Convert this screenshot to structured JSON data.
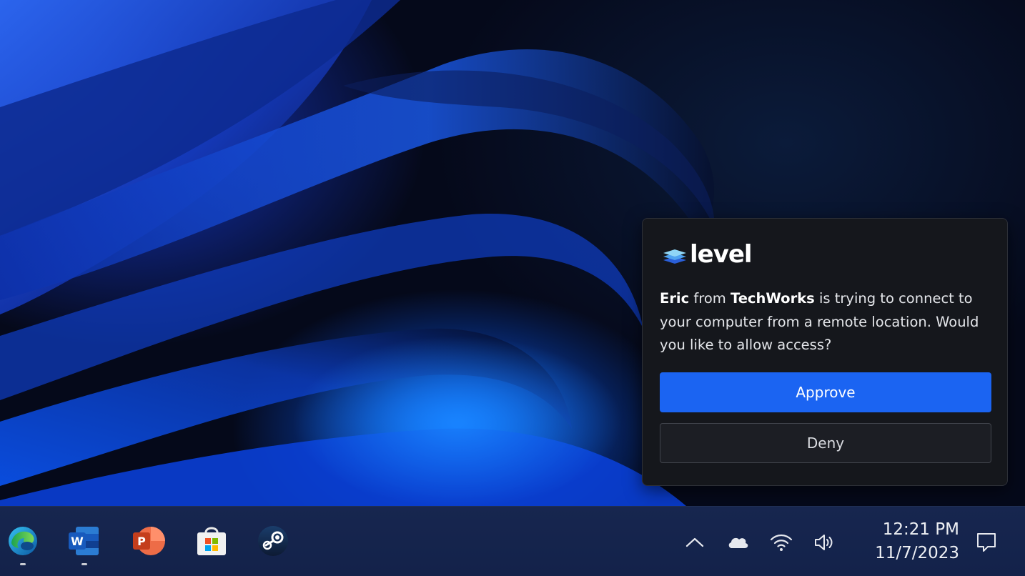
{
  "notification": {
    "brand_name": "level",
    "message": {
      "user": "Eric",
      "from_word": "from",
      "organization": "TechWorks",
      "text": "is trying to connect to your computer from a remote location. Would you like to allow access?"
    },
    "approve_label": "Approve",
    "deny_label": "Deny",
    "colors": {
      "approve": "#1b64f2",
      "background": "#15171c"
    }
  },
  "taskbar": {
    "apps": [
      {
        "name": "Microsoft Edge",
        "icon": "edge-icon",
        "running": true
      },
      {
        "name": "Microsoft Word",
        "icon": "word-icon",
        "running": true
      },
      {
        "name": "Microsoft PowerPoint",
        "icon": "powerpoint-icon",
        "running": false
      },
      {
        "name": "Microsoft Store",
        "icon": "store-icon",
        "running": false
      },
      {
        "name": "Steam",
        "icon": "steam-icon",
        "running": false
      }
    ],
    "tray_icons": [
      "chevron-up-icon",
      "cloud-icon",
      "wifi-icon",
      "volume-icon"
    ],
    "time": "12:21 PM",
    "date": "11/7/2023"
  }
}
